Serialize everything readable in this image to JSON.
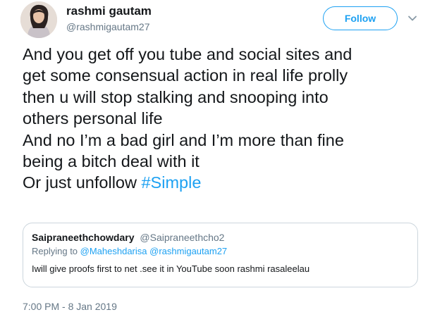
{
  "author": {
    "display_name": "rashmi gautam",
    "handle": "@rashmigautam27"
  },
  "follow_button": {
    "label": "Follow"
  },
  "menu": {
    "icon": "chevron-down-icon"
  },
  "tweet": {
    "lines": [
      "And you get off you tube and social sites and",
      "get some consensual action in real life prolly",
      "then u will stop stalking and snooping into",
      "others personal life",
      "And no I’m a bad girl and I’m more than fine",
      "being a bitch deal with it",
      "Or just unfollow "
    ],
    "hashtag": "#Simple"
  },
  "quoted_tweet": {
    "display_name": "Saipraneethchowdary",
    "handle": "@Saipraneethcho2",
    "replying_prefix": "Replying to ",
    "replying_to": [
      "@Maheshdarisa",
      "@rashmigautam27"
    ],
    "text": "Iwill give proofs first to net .see it in YouTube soon rashmi rasaleelau"
  },
  "timestamp": "7:00 PM - 8 Jan 2019",
  "colors": {
    "accent": "#1da1f2",
    "text": "#14171a",
    "secondary_text": "#657786",
    "border": "#ccd6dd"
  }
}
